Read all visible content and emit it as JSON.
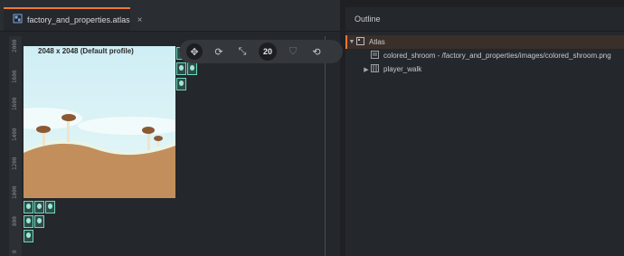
{
  "editor": {
    "tab": {
      "label": "factory_and_properties.atlas",
      "close": "×",
      "icon": "atlas-file-icon"
    },
    "canvas_label": "2048 x 2048 (Default profile)",
    "ruler_ticks": [
      "2000",
      "1600",
      "1600",
      "1400",
      "1200",
      "1000",
      "800",
      "600",
      "0"
    ],
    "toolbar": {
      "grid_size": "20"
    }
  },
  "outline": {
    "title": "Outline",
    "items": [
      {
        "label": "Atlas",
        "expanded": true,
        "icon": "atlas-icon"
      },
      {
        "label": "colored_shroom - /factory_and_properties/images/colored_shroom.png",
        "icon": "image-icon"
      },
      {
        "label": "player_walk",
        "expanded": false,
        "icon": "animation-icon"
      }
    ]
  },
  "colors": {
    "accent": "#f07832",
    "sky": "#d8f3f7",
    "ground": "#c28f5c",
    "sprite_border": "#6fd6c1"
  }
}
